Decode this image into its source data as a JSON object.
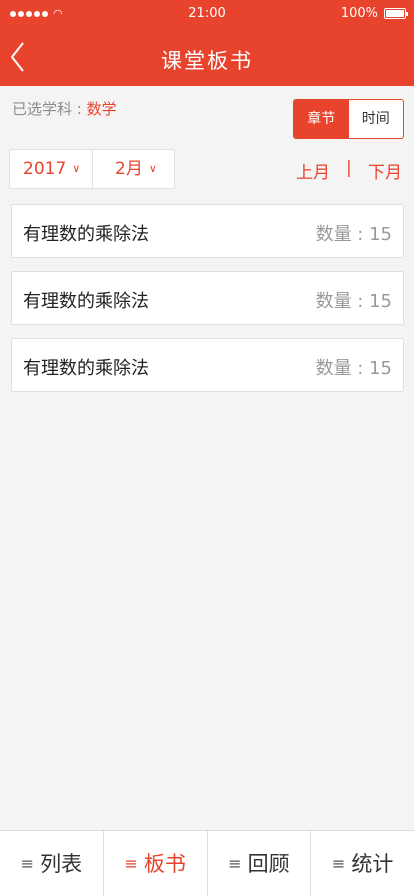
{
  "status": {
    "time": "21:00",
    "battery": "100%"
  },
  "nav": {
    "title": "课堂板书"
  },
  "subject": {
    "label": "已选学科 : ",
    "value": "数学"
  },
  "segment": {
    "chapter": "章节",
    "time": "时间"
  },
  "picker": {
    "year": "2017",
    "month": "2月"
  },
  "monthnav": {
    "prev": "上月",
    "separator": "|",
    "next": "下月"
  },
  "list": [
    {
      "name": "有理数的乘除法",
      "count": "数量 : 15"
    },
    {
      "name": "有理数的乘除法",
      "count": "数量 : 15"
    },
    {
      "name": "有理数的乘除法",
      "count": "数量 : 15"
    }
  ],
  "tabs": [
    {
      "label": "列表"
    },
    {
      "label": "板书"
    },
    {
      "label": "回顾"
    },
    {
      "label": "统计"
    }
  ],
  "colors": {
    "accent": "#e8432c",
    "background": "#f4f4f4"
  }
}
